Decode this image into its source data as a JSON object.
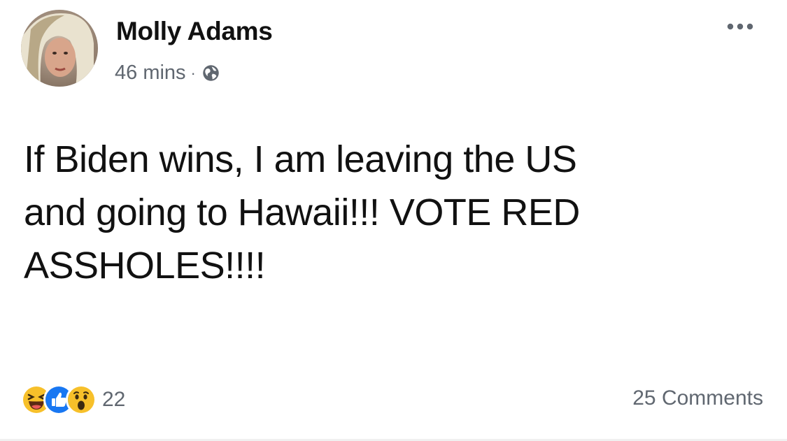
{
  "post": {
    "author": {
      "name": "Molly Adams",
      "avatar_icon": "profile-photo"
    },
    "timestamp": "46 mins",
    "separator": "·",
    "privacy_icon": "globe-icon",
    "menu_icon": "more-options-icon",
    "text": "If Biden wins, I am leaving the US\nand going to Hawaii!!! VOTE RED\nASSHOLES!!!!",
    "reactions": {
      "icons": [
        "haha-icon",
        "like-icon",
        "wow-icon"
      ],
      "count": "22"
    },
    "comments_label": "25 Comments"
  },
  "colors": {
    "like_blue": "#1877f2",
    "reaction_yellow": "#f7c02a",
    "meta_gray": "#606770"
  }
}
